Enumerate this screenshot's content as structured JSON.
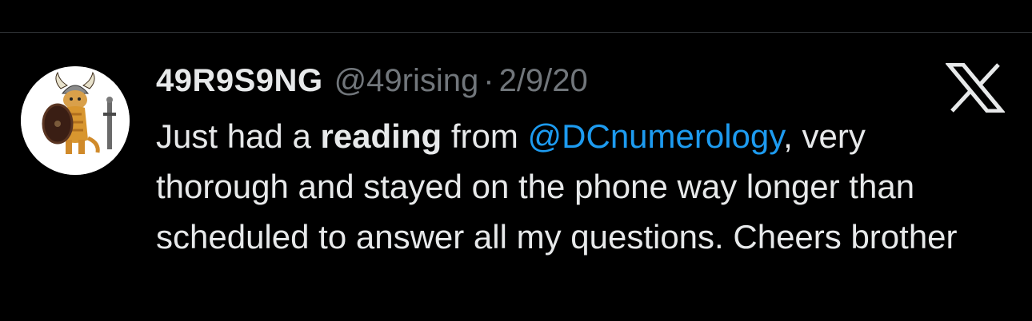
{
  "tweet": {
    "author": {
      "display_name": "49R9S9NG",
      "handle": "@49rising",
      "avatar_icon": "viking-cat-avatar"
    },
    "separator": "·",
    "date": "2/9/20",
    "platform_icon": "x-logo-icon",
    "body": {
      "part1": "Just had a ",
      "bold_word": "reading",
      "part2": " from ",
      "mention": "@DCnumerology",
      "part3": ", very thorough and stayed on the phone way longer than scheduled to answer all my questions. Cheers brother"
    }
  },
  "colors": {
    "background": "#000000",
    "text_primary": "#e7e9ea",
    "text_secondary": "#71767b",
    "mention": "#1d9bf0"
  }
}
